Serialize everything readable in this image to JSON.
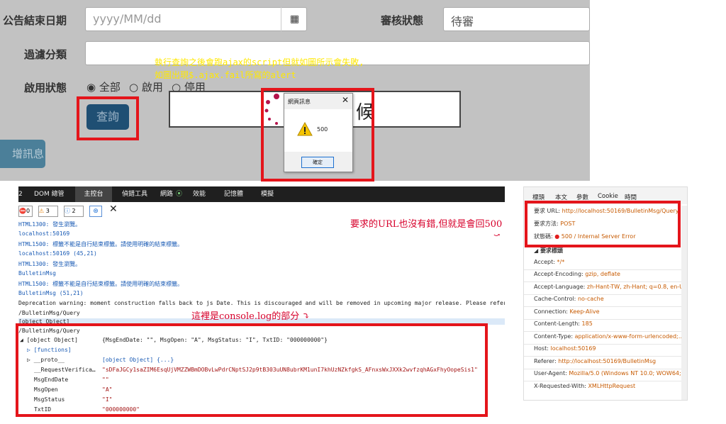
{
  "form": {
    "end_date_label": "公告結束日期",
    "end_date_placeholder": "yyyy/MM/dd",
    "review_status_label": "審核狀態",
    "review_status_value": "待審",
    "filter_category_label": "過濾分類",
    "enable_status_label": "啟用狀態",
    "radio_all": "全部",
    "radio_enabled": "啟用",
    "radio_disabled": "停用",
    "query_button": "查詢",
    "add_button": "增訊息",
    "loading_text": "候"
  },
  "annotations": {
    "ajax_note_line1": "執行查詢之後會跑ajax的script但就如圖所示會失敗,",
    "ajax_note_line2": "如圖出現$.ajax.fail所寫的alert",
    "url_note": "要求的URL也沒有錯,但就是會回500",
    "console_note": "這裡是console.log的部分"
  },
  "dialog": {
    "title": "網頁訊息",
    "close": "✕",
    "message": "500",
    "ok": "確定"
  },
  "devtools": {
    "tabs": [
      "2",
      "DOM 總管",
      "主控台",
      "偵錯工具",
      "網路",
      "效能",
      "記憶體",
      "模擬"
    ],
    "error_count": "0",
    "warning_count": "3",
    "info_count": "2",
    "console_lines": [
      {
        "text": "HTML1300: 發生瀏覽。",
        "color": "blue"
      },
      {
        "text": "localhost:50169",
        "color": "blue"
      },
      {
        "text": "HTML1500: 標籤不能是自行結束標籤。請使用明確的結束標籤。",
        "color": "blue"
      },
      {
        "text": "localhost:50169 (45,21)",
        "color": "blue"
      },
      {
        "text": "HTML1300: 發生瀏覽。",
        "color": "blue"
      },
      {
        "text": "BulletinMsg",
        "color": "blue"
      },
      {
        "text": "HTML1500: 標籤不能是自行結束標籤。請使用明確的結束標籤。",
        "color": "blue"
      },
      {
        "text": "BulletinMsg (51,21)",
        "color": "blue"
      },
      {
        "text": "Deprecation warning: moment construction falls back to js Date. This is discouraged and will be removed in upcoming major release. Please refer t",
        "color": "dark"
      },
      {
        "text": "/BulletinMsg/Query",
        "color": "dark"
      },
      {
        "text": "[object Object]",
        "color": "dark"
      },
      {
        "text": "/BulletinMsg/Query",
        "color": "dark"
      }
    ],
    "tree": {
      "root_label": "◢ [object Object]",
      "root_value": "{MsgEndDate: \"\", MsgOpen: \"A\", MsgStatus: \"I\", TxtID: \"000000000\"}",
      "functions": "▷ [functions]",
      "proto_key": "▷ __proto__",
      "proto_value": "[object Object] {...}",
      "rows": [
        {
          "key": "__RequestVerifica…",
          "value": "\"sDFaJGCy1saZIM6EsqUjVMZZWBmDOBvLwPdrCNptSJ2p9tB303uUN8ubrKM1unI7khUzNZkfgkS_AFnxsWxJXXk2wvfzqhAGxFhyOopeSis1\""
        },
        {
          "key": "MsgEndDate",
          "value": "\"\""
        },
        {
          "key": "MsgOpen",
          "value": "\"A\""
        },
        {
          "key": "MsgStatus",
          "value": "\"I\""
        },
        {
          "key": "TxtID",
          "value": "\"000000000\""
        }
      ]
    }
  },
  "headers_panel": {
    "tabs": [
      "標頭",
      "本文",
      "參數",
      "Cookie",
      "時間"
    ],
    "request_url_label": "要求 URL:",
    "request_url": "http://localhost:50169/BulletinMsg/Query",
    "request_method_label": "要求方法:",
    "request_method": "POST",
    "status_label": "狀態碼:",
    "status": "500 / Internal Server Error",
    "section_title": "◢ 要求標頭",
    "rows": [
      {
        "key": "Accept:",
        "value": "*/*"
      },
      {
        "key": "Accept-Encoding:",
        "value": "gzip, deflate"
      },
      {
        "key": "Accept-Language:",
        "value": "zh-Hant-TW, zh-Hant; q=0.8, en-U…"
      },
      {
        "key": "Cache-Control:",
        "value": "no-cache"
      },
      {
        "key": "Connection:",
        "value": "Keep-Alive"
      },
      {
        "key": "Content-Length:",
        "value": "185"
      },
      {
        "key": "Content-Type:",
        "value": "application/x-www-form-urlencoded;…"
      },
      {
        "key": "Host:",
        "value": "localhost:50169"
      },
      {
        "key": "Referer:",
        "value": "http://localhost:50169/BulletinMsg"
      },
      {
        "key": "User-Agent:",
        "value": "Mozilla/5.0 (Windows NT 10.0; WOW64;…"
      },
      {
        "key": "X-Requested-With:",
        "value": "XMLHttpRequest"
      }
    ]
  },
  "colors": {
    "annotation_red": "#e4151b",
    "annotation_yellow": "#ffe800",
    "status_error": "#e11d1d",
    "header_value": "#c75a00"
  }
}
